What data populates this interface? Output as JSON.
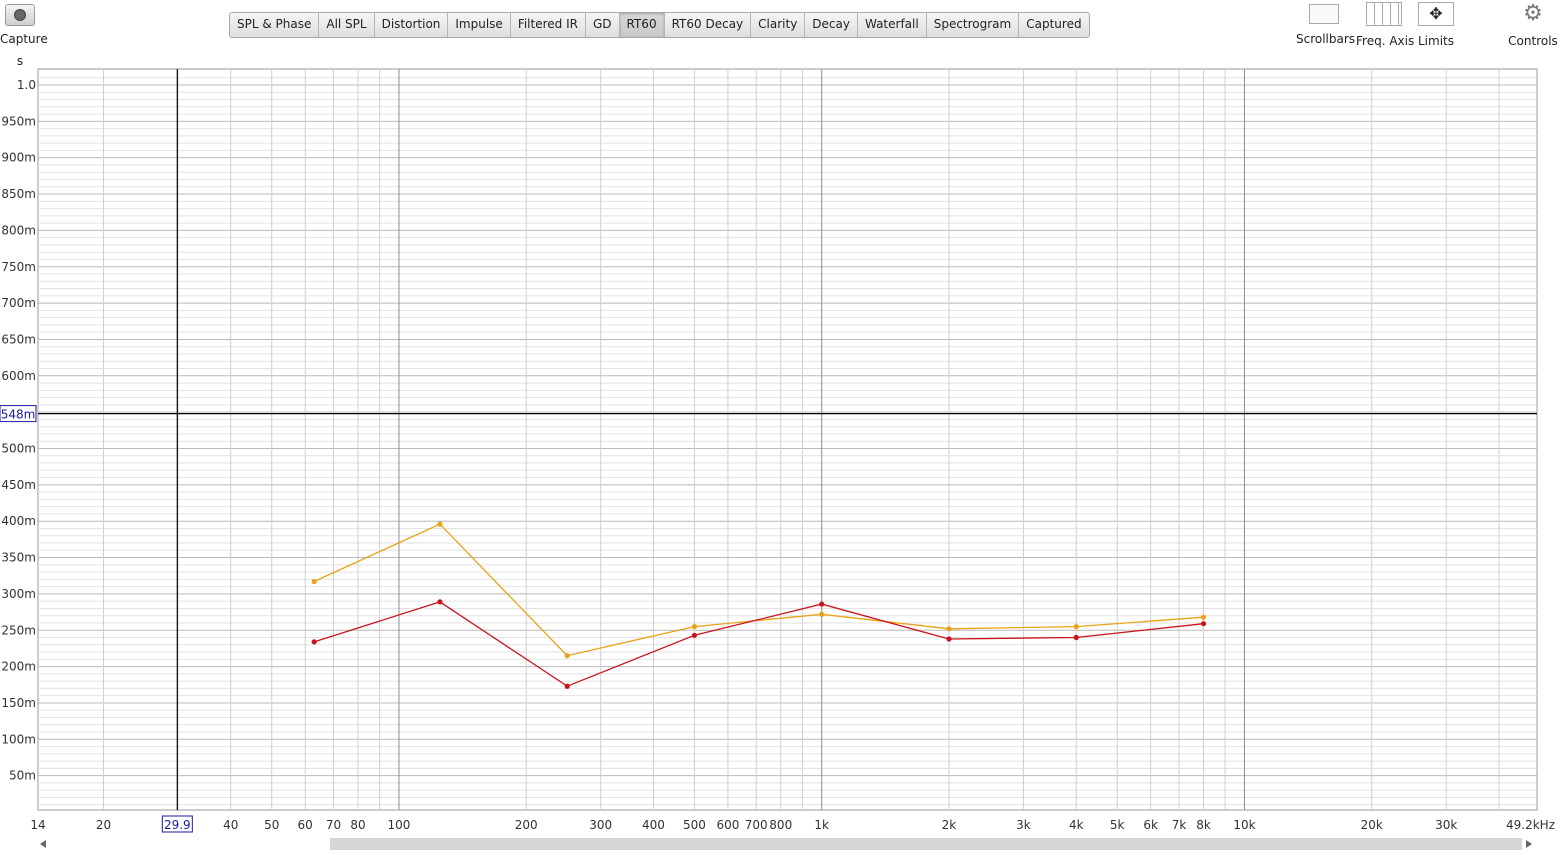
{
  "toolbar": {
    "capture_label": "Capture",
    "tabs": [
      "SPL & Phase",
      "All SPL",
      "Distortion",
      "Impulse",
      "Filtered IR",
      "GD",
      "RT60",
      "RT60 Decay",
      "Clarity",
      "Decay",
      "Waterfall",
      "Spectrogram",
      "Captured"
    ],
    "active_tab": "RT60",
    "tools": {
      "scrollbars": "Scrollbars",
      "freq_axis": "Freq. Axis",
      "limits": "Limits",
      "controls": "Controls"
    }
  },
  "axis_unit_label": "s",
  "cursor": {
    "x_readout": "29.9",
    "y_readout": "548m",
    "x_value": 29.9,
    "y_value": 0.548
  },
  "chart_data": {
    "type": "line",
    "x_scale": "log",
    "xlim": [
      14,
      49200
    ],
    "ylim": [
      0,
      1.0
    ],
    "x_tick_labels": [
      {
        "v": 14,
        "t": "14"
      },
      {
        "v": 20,
        "t": "20"
      },
      {
        "v": 40,
        "t": "40"
      },
      {
        "v": 50,
        "t": "50"
      },
      {
        "v": 60,
        "t": "60"
      },
      {
        "v": 70,
        "t": "70"
      },
      {
        "v": 80,
        "t": "80"
      },
      {
        "v": 100,
        "t": "100"
      },
      {
        "v": 200,
        "t": "200"
      },
      {
        "v": 300,
        "t": "300"
      },
      {
        "v": 400,
        "t": "400"
      },
      {
        "v": 500,
        "t": "500"
      },
      {
        "v": 600,
        "t": "600"
      },
      {
        "v": 700,
        "t": "700"
      },
      {
        "v": 800,
        "t": "800"
      },
      {
        "v": 1000,
        "t": "1k"
      },
      {
        "v": 2000,
        "t": "2k"
      },
      {
        "v": 3000,
        "t": "3k"
      },
      {
        "v": 4000,
        "t": "4k"
      },
      {
        "v": 5000,
        "t": "5k"
      },
      {
        "v": 6000,
        "t": "6k"
      },
      {
        "v": 7000,
        "t": "7k"
      },
      {
        "v": 8000,
        "t": "8k"
      },
      {
        "v": 10000,
        "t": "10k"
      },
      {
        "v": 20000,
        "t": "20k"
      },
      {
        "v": 30000,
        "t": "30k"
      },
      {
        "v": 49200,
        "t": "49.2kHz"
      }
    ],
    "y_tick_labels": [
      {
        "v": 1.0,
        "t": "1.0"
      },
      {
        "v": 0.95,
        "t": "950m"
      },
      {
        "v": 0.9,
        "t": "900m"
      },
      {
        "v": 0.85,
        "t": "850m"
      },
      {
        "v": 0.8,
        "t": "800m"
      },
      {
        "v": 0.75,
        "t": "750m"
      },
      {
        "v": 0.7,
        "t": "700m"
      },
      {
        "v": 0.65,
        "t": "650m"
      },
      {
        "v": 0.6,
        "t": "600m"
      },
      {
        "v": 0.5,
        "t": "500m"
      },
      {
        "v": 0.45,
        "t": "450m"
      },
      {
        "v": 0.4,
        "t": "400m"
      },
      {
        "v": 0.35,
        "t": "350m"
      },
      {
        "v": 0.3,
        "t": "300m"
      },
      {
        "v": 0.25,
        "t": "250m"
      },
      {
        "v": 0.2,
        "t": "200m"
      },
      {
        "v": 0.15,
        "t": "150m"
      },
      {
        "v": 0.1,
        "t": "100m"
      },
      {
        "v": 0.05,
        "t": "50m"
      }
    ],
    "x": [
      63,
      125,
      250,
      500,
      1000,
      2000,
      4000,
      8000
    ],
    "series": [
      {
        "color": "#e8a317",
        "values": [
          0.317,
          0.396,
          0.215,
          0.255,
          0.272,
          0.252,
          0.255,
          0.268
        ]
      },
      {
        "color": "#c8141e",
        "values": [
          0.234,
          0.289,
          0.173,
          0.243,
          0.286,
          0.238,
          0.24,
          0.259
        ]
      }
    ],
    "grid": true
  }
}
